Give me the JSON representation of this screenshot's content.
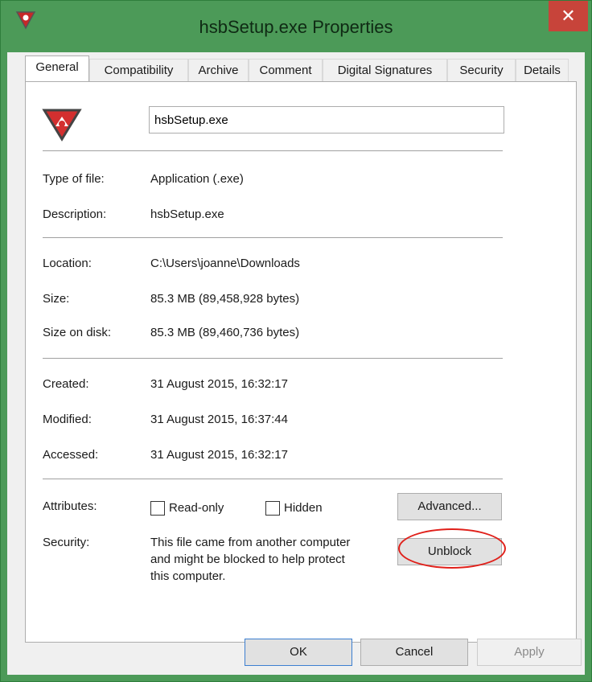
{
  "window": {
    "title": "hsbSetup.exe Properties",
    "close_glyph": "✕"
  },
  "tabs": [
    {
      "label": "General"
    },
    {
      "label": "Compatibility"
    },
    {
      "label": "Archive"
    },
    {
      "label": "Comment"
    },
    {
      "label": "Digital Signatures"
    },
    {
      "label": "Security"
    },
    {
      "label": "Details"
    }
  ],
  "general": {
    "file_name": "hsbSetup.exe",
    "type_label": "Type of file:",
    "type_value": "Application (.exe)",
    "desc_label": "Description:",
    "desc_value": "hsbSetup.exe",
    "location_label": "Location:",
    "location_value": "C:\\Users\\joanne\\Downloads",
    "size_label": "Size:",
    "size_value": "85.3 MB (89,458,928 bytes)",
    "size_disk_label": "Size on disk:",
    "size_disk_value": "85.3 MB (89,460,736 bytes)",
    "created_label": "Created:",
    "created_value": "31 August 2015, 16:32:17",
    "modified_label": "Modified:",
    "modified_value": "31 August 2015, 16:37:44",
    "accessed_label": "Accessed:",
    "accessed_value": "31 August 2015, 16:32:17",
    "attributes_label": "Attributes:",
    "readonly_label": "Read-only",
    "hidden_label": "Hidden",
    "advanced_label": "Advanced...",
    "security_label": "Security:",
    "security_line1": "This file came from another computer",
    "security_line2": "and might be blocked to help protect",
    "security_line3": "this computer.",
    "unblock_label": "Unblock"
  },
  "footer": {
    "ok_label": "OK",
    "cancel_label": "Cancel",
    "apply_label": "Apply"
  },
  "colors": {
    "title_bar": "#4c9a58",
    "close_button": "#c7443a",
    "highlight_ring": "#e0201a",
    "disabled_text": "#8a8a8a"
  },
  "icons": {
    "app": "shield-arrow-icon",
    "file": "hsb-shield-icon"
  }
}
